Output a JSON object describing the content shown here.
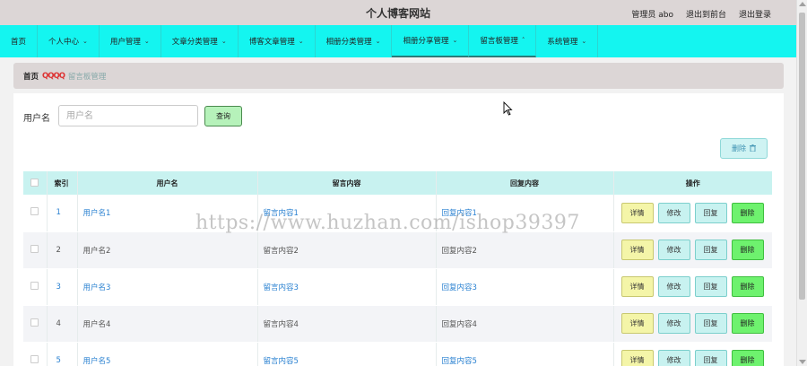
{
  "header": {
    "title": "个人博客网站",
    "admin_label": "管理员 abo",
    "exit_to_front": "退出到前台",
    "logout": "退出登录"
  },
  "nav": {
    "items": [
      {
        "label": "首页",
        "has_dropdown": false
      },
      {
        "label": "个人中心",
        "has_dropdown": true
      },
      {
        "label": "用户管理",
        "has_dropdown": true
      },
      {
        "label": "文章分类管理",
        "has_dropdown": true
      },
      {
        "label": "博客文章管理",
        "has_dropdown": true
      },
      {
        "label": "相册分类管理",
        "has_dropdown": true
      },
      {
        "label": "相册分享管理",
        "has_dropdown": true
      },
      {
        "label": "留言板管理",
        "has_dropdown": true,
        "active": true
      },
      {
        "label": "系统管理",
        "has_dropdown": true
      }
    ]
  },
  "breadcrumb": {
    "home": "首页",
    "separator": "QQQQ",
    "current": "留言板管理"
  },
  "search": {
    "label": "用户名",
    "placeholder": "用户名",
    "value": "",
    "query_button": "查询"
  },
  "toolbar": {
    "delete_button": "删除"
  },
  "table": {
    "headers": [
      "",
      "索引",
      "用户名",
      "留言内容",
      "回复内容",
      "操作"
    ],
    "rows": [
      {
        "index": "1",
        "username": "用户名1",
        "message": "留言内容1",
        "reply": "回复内容1"
      },
      {
        "index": "2",
        "username": "用户名2",
        "message": "留言内容2",
        "reply": "回复内容2"
      },
      {
        "index": "3",
        "username": "用户名3",
        "message": "留言内容3",
        "reply": "回复内容3"
      },
      {
        "index": "4",
        "username": "用户名4",
        "message": "留言内容4",
        "reply": "回复内容4"
      },
      {
        "index": "5",
        "username": "用户名5",
        "message": "留言内容5",
        "reply": "回复内容5"
      }
    ],
    "actions": {
      "detail": "详情",
      "edit": "修改",
      "reply": "回复",
      "delete": "删除"
    }
  },
  "watermark": "https://www.huzhan.com/ishop39397",
  "colors": {
    "navbar_bg": "#14f5f0",
    "header_bg": "#dcd6d6",
    "link": "#2b82d1",
    "delete_green": "#6ef26e"
  }
}
